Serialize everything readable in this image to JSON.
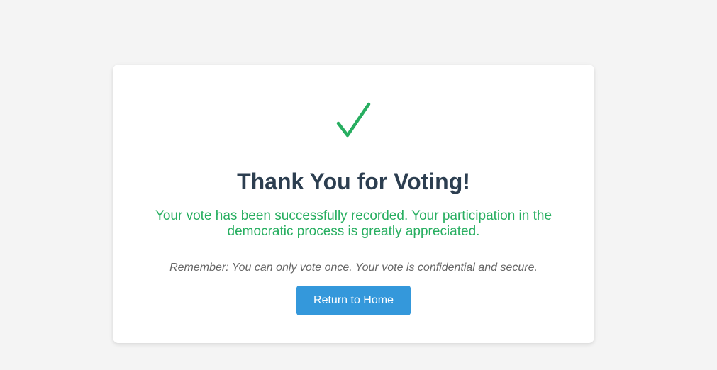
{
  "colors": {
    "background": "#f4f4f4",
    "card": "#ffffff",
    "success": "#27ae60",
    "title": "#2c3e50",
    "note": "#666666",
    "button": "#3498db"
  },
  "confirmation": {
    "icon": "check-icon",
    "title": "Thank You for Voting!",
    "message_line1": "Your vote has been successfully recorded. Your participation in the",
    "message_line2": "democratic process is greatly appreciated.",
    "note": "Remember: You can only vote once. Your vote is confidential and secure.",
    "button_label": "Return to Home"
  }
}
